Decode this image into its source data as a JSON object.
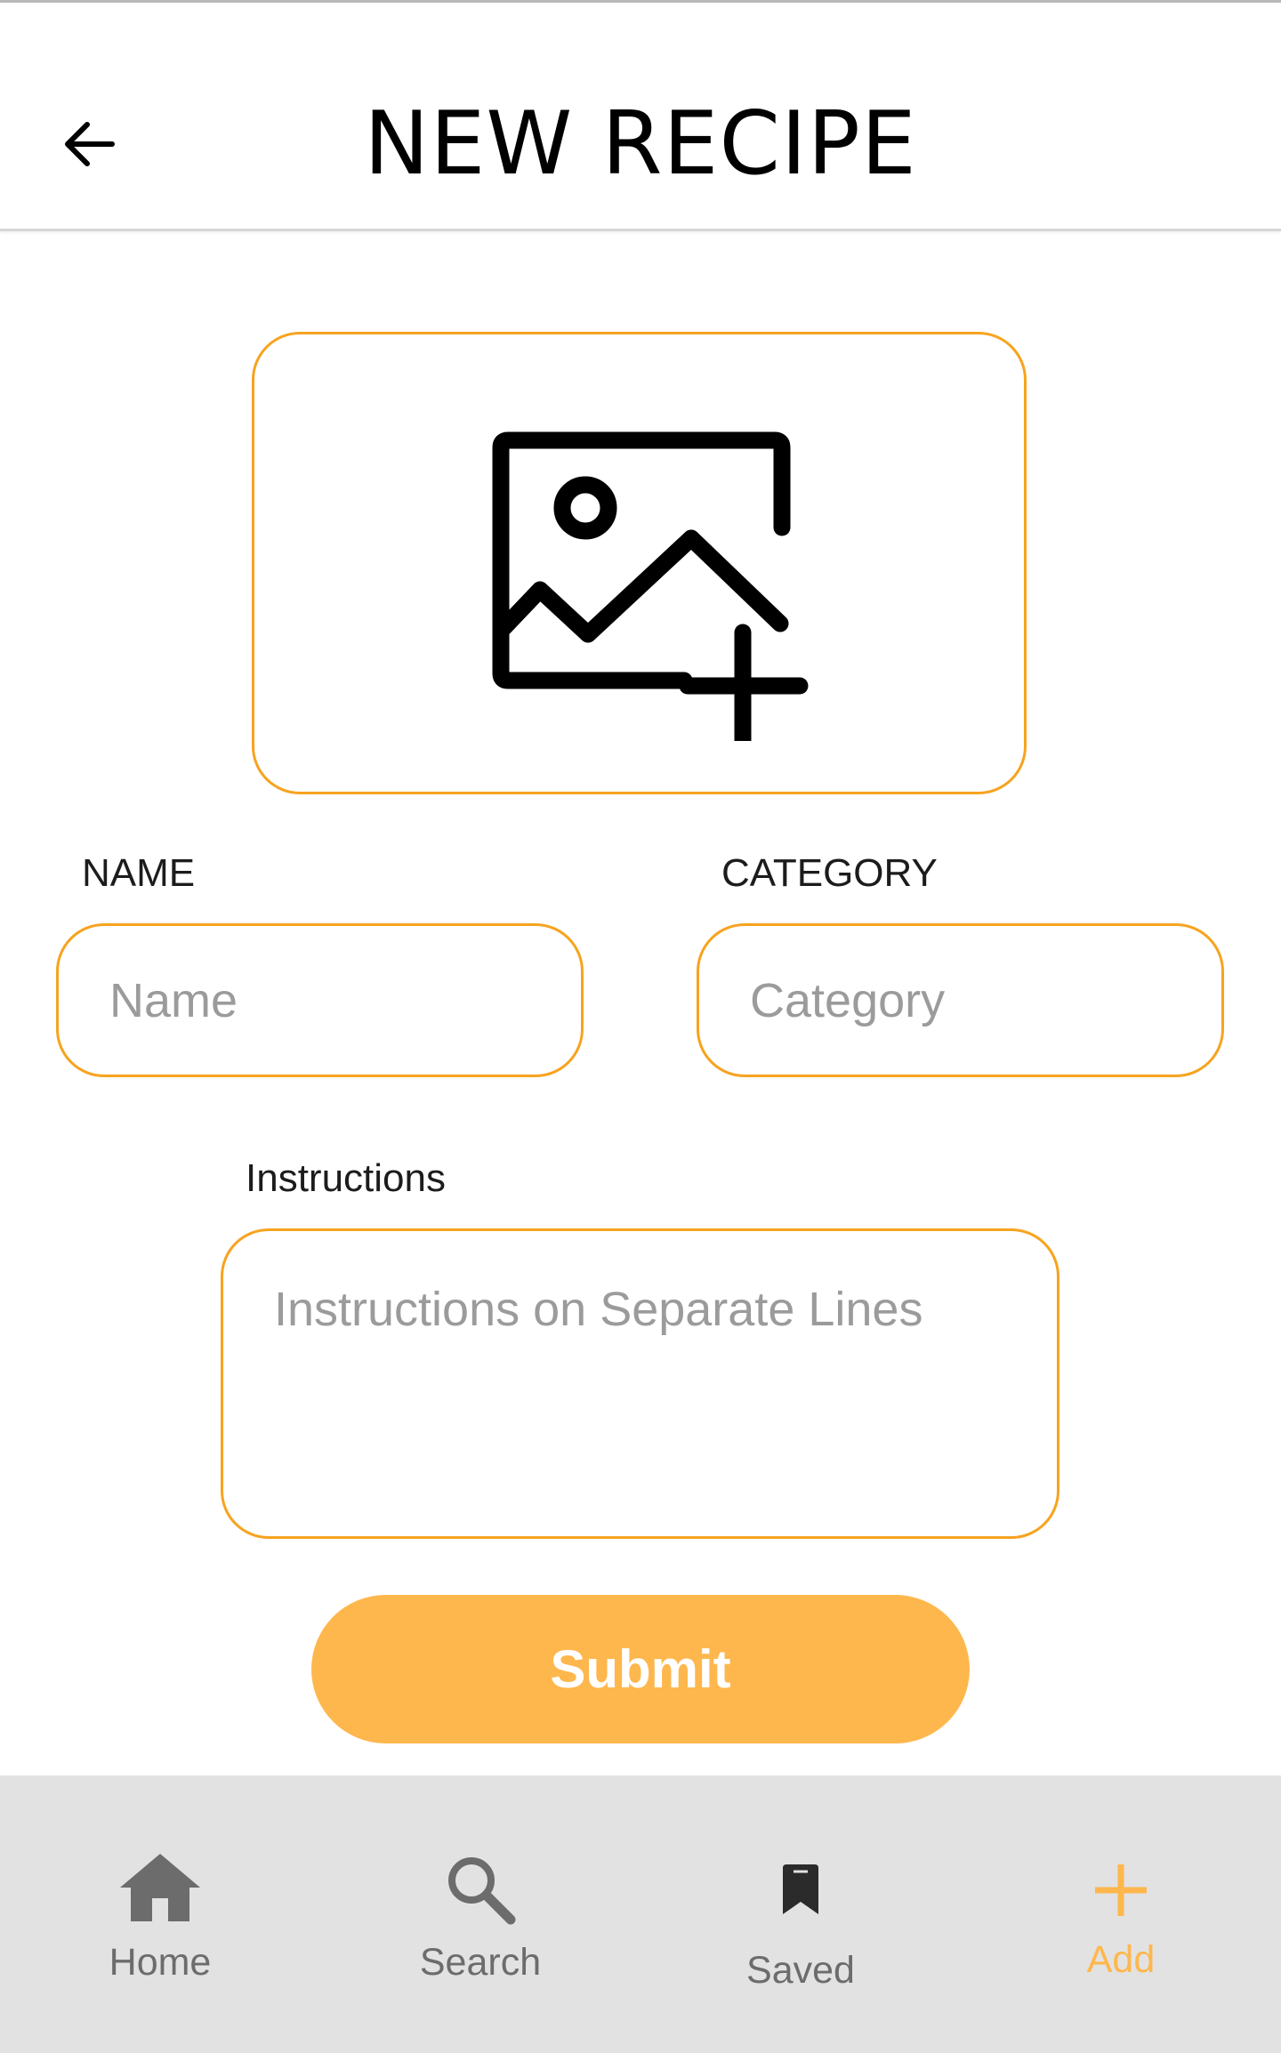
{
  "header": {
    "title": "NEW RECIPE",
    "back_icon": "arrow-left-icon"
  },
  "image_picker": {
    "icon": "add-photo-icon"
  },
  "form": {
    "name_label": "NAME",
    "name_placeholder": "Name",
    "name_value": "",
    "category_label": "CATEGORY",
    "category_placeholder": "Category",
    "category_value": "",
    "instructions_label": "Instructions",
    "instructions_placeholder": "Instructions on Separate Lines",
    "instructions_value": "",
    "submit_label": "Submit"
  },
  "bottom_nav": {
    "items": [
      {
        "label": "Home",
        "icon": "home-icon",
        "active": false
      },
      {
        "label": "Search",
        "icon": "search-icon",
        "active": false
      },
      {
        "label": "Saved",
        "icon": "bookmark-icon",
        "active": false
      },
      {
        "label": "Add",
        "icon": "plus-icon",
        "active": true
      }
    ]
  },
  "colors": {
    "accent": "#feb74d",
    "border_accent": "#f7a31f",
    "nav_background": "#e2e2e2",
    "nav_inactive": "#6c6c6c"
  }
}
